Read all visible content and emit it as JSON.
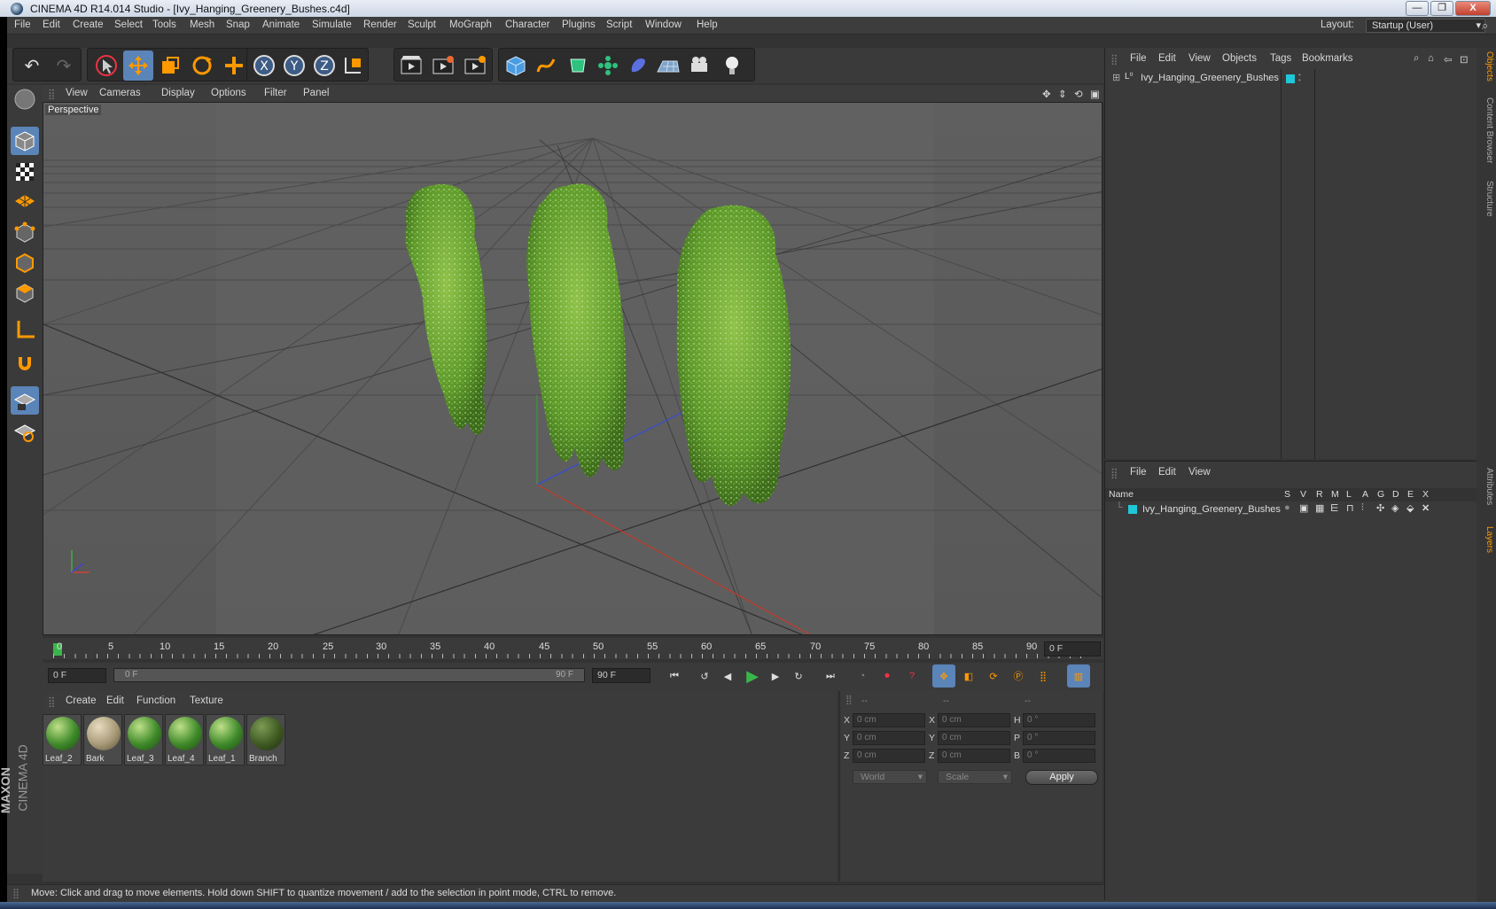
{
  "window": {
    "title": "CINEMA 4D R14.014 Studio - [Ivy_Hanging_Greenery_Bushes.c4d]",
    "min": "—",
    "max": "❐",
    "close": "X"
  },
  "menu": [
    "File",
    "Edit",
    "Create",
    "Select",
    "Tools",
    "Mesh",
    "Snap",
    "Animate",
    "Simulate",
    "Render",
    "Sculpt",
    "MoGraph",
    "Character",
    "Plugins",
    "Script",
    "Window",
    "Help"
  ],
  "layout": {
    "label": "Layout:",
    "value": "Startup (User)"
  },
  "viewport": {
    "menu": [
      "View",
      "Cameras",
      "Display",
      "Options",
      "Filter",
      "Panel"
    ],
    "label": "Perspective"
  },
  "timeline": {
    "ticks": [
      "0",
      "5",
      "10",
      "15",
      "20",
      "25",
      "30",
      "35",
      "40",
      "45",
      "50",
      "55",
      "60",
      "65",
      "70",
      "75",
      "80",
      "85",
      "90"
    ],
    "current": "0 F"
  },
  "transport": {
    "start": "0 F",
    "range_start": "0 F",
    "range_end": "90 F",
    "end": "90 F"
  },
  "materials": {
    "menu": [
      "Create",
      "Edit",
      "Function",
      "Texture"
    ],
    "items": [
      {
        "name": "Leaf_2",
        "color": "#3f8a2a"
      },
      {
        "name": "Bark",
        "color": "#a89a78"
      },
      {
        "name": "Leaf_3",
        "color": "#3f8a2a"
      },
      {
        "name": "Leaf_4",
        "color": "#3f8a2a"
      },
      {
        "name": "Leaf_1",
        "color": "#3f8a2a"
      },
      {
        "name": "Branch",
        "color": "#3f5a22"
      }
    ]
  },
  "coords": {
    "headers": [
      "--",
      "--",
      "--"
    ],
    "rows": [
      {
        "a": "X",
        "av": "0 cm",
        "b": "X",
        "bv": "0 cm",
        "c": "H",
        "cv": "0 °"
      },
      {
        "a": "Y",
        "av": "0 cm",
        "b": "Y",
        "bv": "0 cm",
        "c": "P",
        "cv": "0 °"
      },
      {
        "a": "Z",
        "av": "0 cm",
        "b": "Z",
        "bv": "0 cm",
        "c": "B",
        "cv": "0 °"
      }
    ],
    "world": "World",
    "scale": "Scale",
    "apply": "Apply"
  },
  "objects": {
    "menu": [
      "File",
      "Edit",
      "View",
      "Objects",
      "Tags",
      "Bookmarks"
    ],
    "item": "Ivy_Hanging_Greenery_Bushes"
  },
  "layers": {
    "menu": [
      "File",
      "Edit",
      "View"
    ],
    "name_col": "Name",
    "cols": [
      "S",
      "V",
      "R",
      "M",
      "L",
      "A",
      "G",
      "D",
      "E",
      "X"
    ],
    "item": "Ivy_Hanging_Greenery_Bushes"
  },
  "right_tabs": [
    "Objects",
    "Content Browser",
    "Structure",
    "Attributes",
    "Layers"
  ],
  "status": "Move: Click and drag to move elements. Hold down SHIFT to quantize movement / add to the selection in point mode, CTRL to remove.",
  "brand": {
    "maxon": "MAXON",
    "c4d": "CINEMA 4D"
  },
  "colors": {
    "accent": "#5b84b8",
    "layer_color": "#1ec8d8",
    "ivy": "#6aa531"
  }
}
